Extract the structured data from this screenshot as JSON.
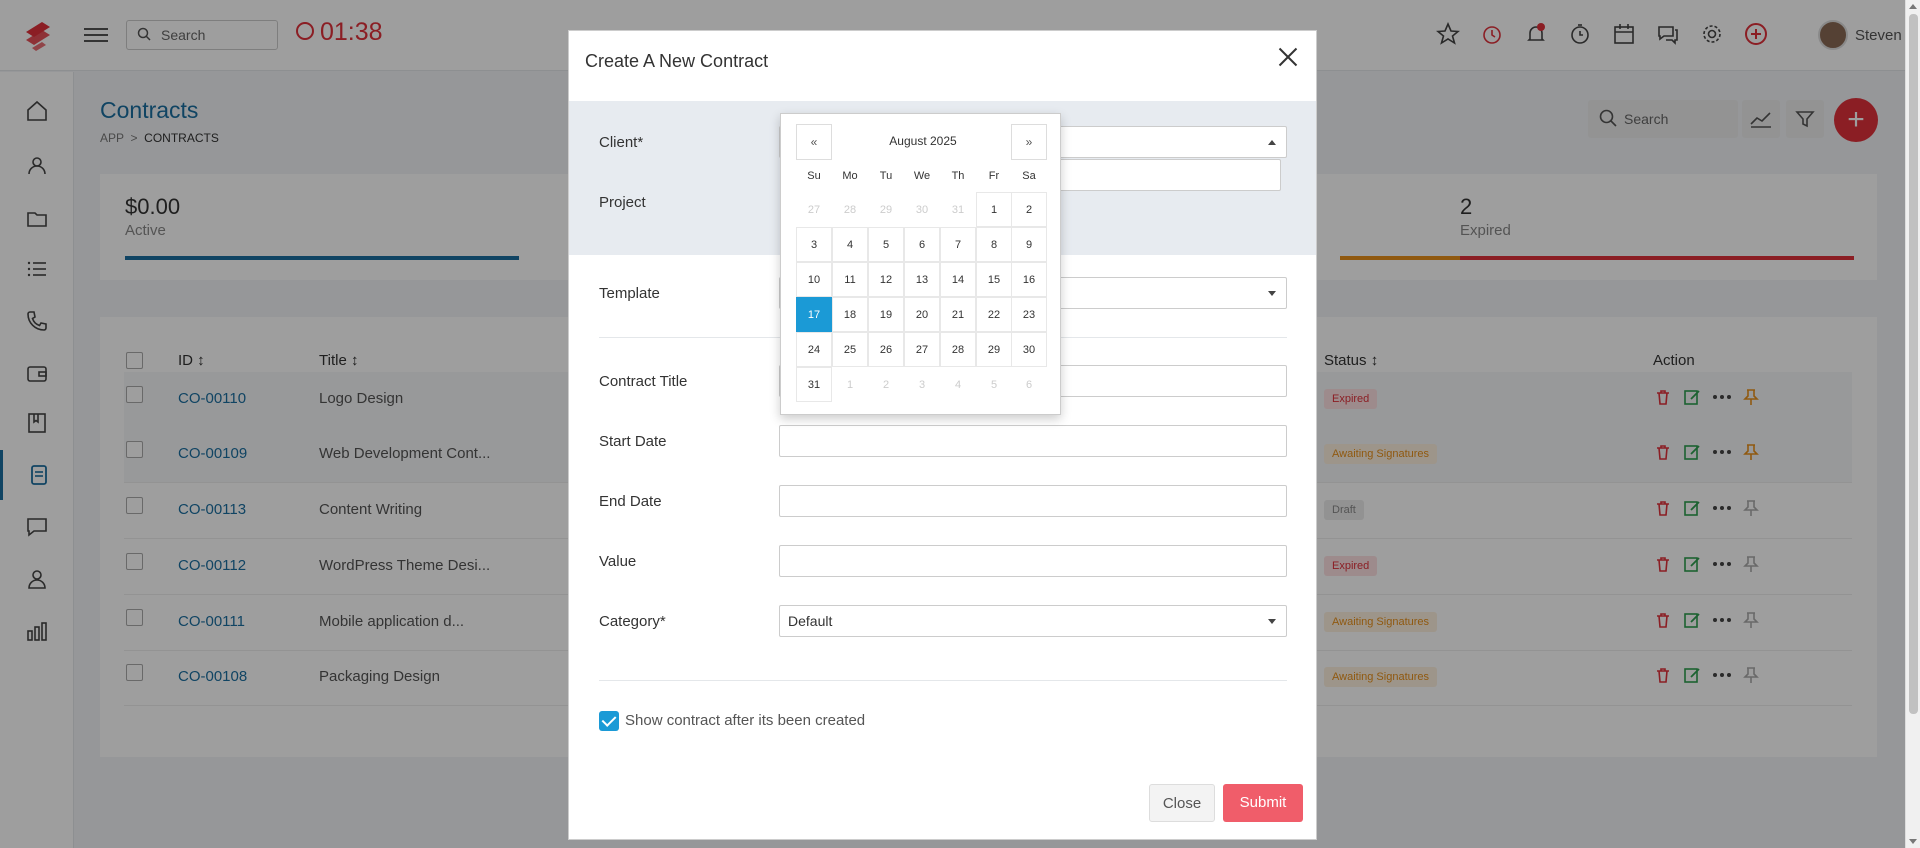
{
  "topbar": {
    "search_placeholder": "Search",
    "timer": "01:38",
    "user_name": "Steven"
  },
  "page": {
    "title": "Contracts",
    "breadcrumb": [
      "APP",
      "CONTRACTS"
    ],
    "search_placeholder": "Search"
  },
  "stats": [
    {
      "value": "$0.00",
      "label": "Active",
      "color": "#1b6fa0"
    },
    {
      "value": "2",
      "label": "Expired",
      "color": "#e0313b"
    }
  ],
  "table": {
    "headers": {
      "id": "ID",
      "title": "Title",
      "status": "Status",
      "action": "Action"
    },
    "rows": [
      {
        "id": "CO-00110",
        "title": "Logo Design",
        "status": "Expired"
      },
      {
        "id": "CO-00109",
        "title": "Web Development Cont...",
        "status": "Awaiting Signatures"
      },
      {
        "id": "CO-00113",
        "title": "Content Writing",
        "status": "Draft"
      },
      {
        "id": "CO-00112",
        "title": "WordPress Theme Desi...",
        "status": "Expired"
      },
      {
        "id": "CO-00111",
        "title": "Mobile application d...",
        "status": "Awaiting Signatures"
      },
      {
        "id": "CO-00108",
        "title": "Packaging Design",
        "status": "Awaiting Signatures"
      }
    ]
  },
  "modal": {
    "title": "Create A New Contract",
    "labels": {
      "client": "Client*",
      "project": "Project",
      "template": "Template",
      "contract_title": "Contract Title",
      "start_date": "Start Date",
      "end_date": "End Date",
      "value": "Value",
      "category": "Category*"
    },
    "category_value": "Default",
    "checkbox_label": "Show contract after its been created",
    "close_label": "Close",
    "submit_label": "Submit"
  },
  "datepicker": {
    "prev": "«",
    "next": "»",
    "month_label": "August 2025",
    "weekdays": [
      "Su",
      "Mo",
      "Tu",
      "We",
      "Th",
      "Fr",
      "Sa"
    ],
    "days": [
      [
        "27",
        "28",
        "29",
        "30",
        "31",
        "1",
        "2"
      ],
      [
        "3",
        "4",
        "5",
        "6",
        "7",
        "8",
        "9"
      ],
      [
        "10",
        "11",
        "12",
        "13",
        "14",
        "15",
        "16"
      ],
      [
        "17",
        "18",
        "19",
        "20",
        "21",
        "22",
        "23"
      ],
      [
        "24",
        "25",
        "26",
        "27",
        "28",
        "29",
        "30"
      ],
      [
        "31",
        "1",
        "2",
        "3",
        "4",
        "5",
        "6"
      ]
    ],
    "selected": "17"
  },
  "colors": {
    "brand": "#1b6fa0",
    "accent_red": "#e0313b",
    "datepicker_selected": "#1b9ad6",
    "submit": "#f05d6a"
  }
}
